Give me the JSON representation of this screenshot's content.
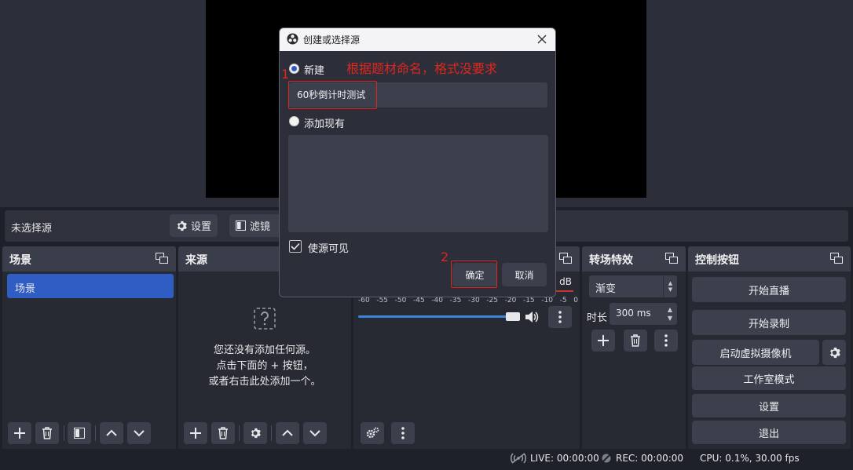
{
  "source_bar": {
    "no_source": "未选择源",
    "settings_label": "设置",
    "filters_label": "滤镜"
  },
  "docks": {
    "scenes": {
      "title": "场景",
      "items": [
        "场景"
      ]
    },
    "sources": {
      "title": "来源",
      "empty_line1": "您还没有添加任何源。",
      "empty_line2": "点击下面的 + 按钮，",
      "empty_line3": "或者右击此处添加一个。"
    },
    "mixer": {
      "db": "0 dB",
      "scale": [
        "-60",
        "-55",
        "-50",
        "-45",
        "-40",
        "-35",
        "-30",
        "-25",
        "-20",
        "-15",
        "-10",
        "-5",
        "0"
      ]
    },
    "transitions": {
      "title": "转场特效",
      "selected": "渐变",
      "duration_label": "时长",
      "duration_value": "300 ms"
    },
    "controls": {
      "title": "控制按钮",
      "start_stream": "开始直播",
      "start_record": "开始录制",
      "virtual_cam": "启动虚拟摄像机",
      "studio_mode": "工作室模式",
      "settings": "设置",
      "exit": "退出"
    }
  },
  "status": {
    "live": "LIVE: 00:00:00",
    "rec": "REC: 00:00:00",
    "cpu": "CPU: 0.1%, 30.00 fps"
  },
  "dialog": {
    "title": "创建或选择源",
    "new_label": "新建",
    "name_value": "60秒倒计时测试",
    "add_existing_label": "添加现有",
    "visible_label": "使源可见",
    "ok_label": "确定",
    "cancel_label": "取消"
  },
  "annotations": {
    "note": "根据题材命名，格式没要求",
    "step1": "1",
    "step2": "2"
  },
  "colors": {
    "accent": "#2f5dc4",
    "annotation": "#e0251c",
    "meter": "#3b86d9"
  }
}
